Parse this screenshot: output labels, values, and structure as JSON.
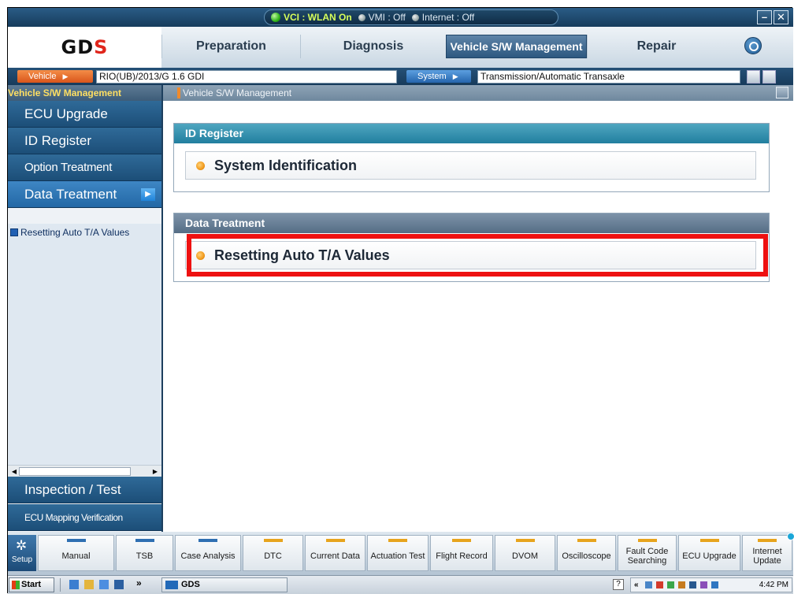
{
  "titlebar": {
    "vci": "VCI : WLAN On",
    "vmi": "VMI : Off",
    "internet": "Internet : Off",
    "minimize": "–",
    "close": "✕"
  },
  "nav": {
    "logo_main": "GD",
    "logo_accent": "S",
    "tabs": [
      "Preparation",
      "Diagnosis",
      "Vehicle S/W Management",
      "Repair"
    ],
    "active_tab": "Vehicle S/W Management"
  },
  "vehicle_row": {
    "vehicle_label": "Vehicle",
    "vehicle_value": "RIO(UB)/2013/G 1.6 GDI",
    "system_label": "System",
    "system_value": "Transmission/Automatic Transaxle"
  },
  "sidebar": {
    "header": "Vehicle S/W Management",
    "items": [
      "ECU Upgrade",
      "ID Register",
      "Option Treatment",
      "Data Treatment"
    ],
    "active_item": "Data Treatment",
    "sub_item": "Resetting Auto T/A Values",
    "bottom_items": [
      "Inspection / Test",
      "ECU Mapping Verification"
    ]
  },
  "main": {
    "breadcrumb": "Vehicle S/W Management",
    "panels": [
      {
        "header": "ID Register",
        "item": "System Identification"
      },
      {
        "header": "Data Treatment",
        "item": "Resetting Auto T/A Values"
      }
    ]
  },
  "toolbar": {
    "setup": "Setup",
    "buttons": [
      {
        "label": "Manual",
        "bar": "blue"
      },
      {
        "label": "TSB",
        "bar": "blue"
      },
      {
        "label": "Case Analysis",
        "bar": "blue"
      },
      {
        "label": "DTC",
        "bar": "yellow"
      },
      {
        "label": "Current Data",
        "bar": "yellow"
      },
      {
        "label": "Actuation Test",
        "bar": "yellow"
      },
      {
        "label": "Flight Record",
        "bar": "yellow"
      },
      {
        "label": "DVOM",
        "bar": "yellow"
      },
      {
        "label": "Oscilloscope",
        "bar": "yellow"
      },
      {
        "label": "Fault Code Searching",
        "bar": "yellow"
      },
      {
        "label": "ECU Upgrade",
        "bar": "yellow"
      },
      {
        "label": "Internet Update",
        "bar": "yellow"
      }
    ]
  },
  "taskbar": {
    "start": "Start",
    "quick_more": "»",
    "app": "GDS",
    "tray_more": "«",
    "time": "4:42 PM",
    "help": "?"
  }
}
